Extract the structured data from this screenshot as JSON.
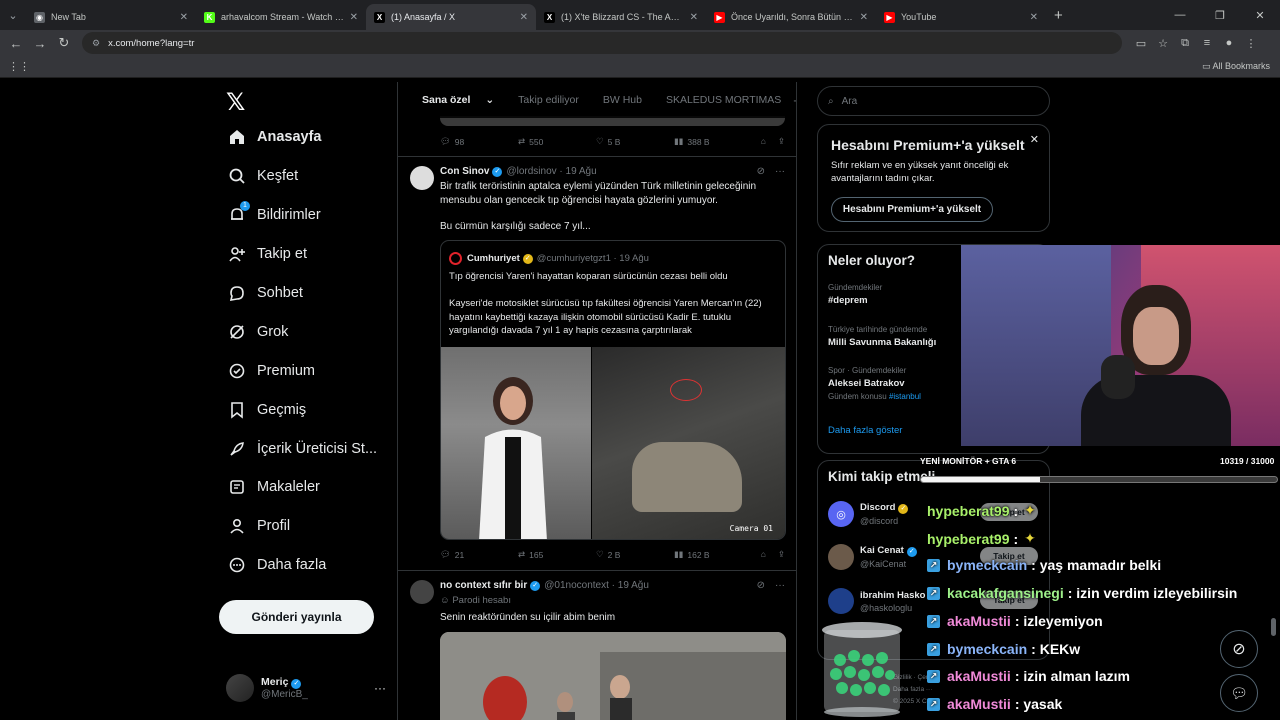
{
  "browser": {
    "tabs": [
      {
        "label": "New Tab",
        "color": "#5f6368",
        "glyph": "◉"
      },
      {
        "label": "arhavalcom Stream - Watch Liv",
        "color": "#53fc18",
        "glyph": "K"
      },
      {
        "label": "(1) Anasayfa / X",
        "color": "#000000",
        "glyph": "X"
      },
      {
        "label": "(1) X'te Blizzard CS - The Ameri",
        "color": "#000000",
        "glyph": "X"
      },
      {
        "label": "Önce Uyarıldı, Sonra Bütün Ma",
        "color": "#ff0000",
        "glyph": "▶"
      },
      {
        "label": "YouTube",
        "color": "#ff0000",
        "glyph": "▶"
      }
    ],
    "url": "x.com/home?lang=tr",
    "all_bookmarks": "All Bookmarks"
  },
  "nav": {
    "items": [
      {
        "label": "Anasayfa",
        "icon": "home-icon"
      },
      {
        "label": "Keşfet",
        "icon": "search-icon"
      },
      {
        "label": "Bildirimler",
        "icon": "bell-icon"
      },
      {
        "label": "Takip et",
        "icon": "follow-icon"
      },
      {
        "label": "Sohbet",
        "icon": "chat-icon"
      },
      {
        "label": "Grok",
        "icon": "grok-icon"
      },
      {
        "label": "Premium",
        "icon": "premium-icon"
      },
      {
        "label": "Geçmiş",
        "icon": "bookmark-icon"
      },
      {
        "label": "İçerik Üreticisi St...",
        "icon": "rocket-icon"
      },
      {
        "label": "Makaleler",
        "icon": "article-icon"
      },
      {
        "label": "Profil",
        "icon": "profile-icon"
      },
      {
        "label": "Daha fazla",
        "icon": "more-icon"
      }
    ],
    "notif_badge": "1",
    "post_button": "Gönderi yayınla",
    "user_name": "Meriç",
    "user_handle": "@MericB_"
  },
  "timeline": {
    "tabs": [
      "Sana özel",
      "Takip ediliyor",
      "BW Hub",
      "SKALEDUS MORTIMAS"
    ],
    "top_actions": {
      "replies": "98",
      "reposts": "550",
      "likes": "5 B",
      "views": "388 B"
    },
    "post1": {
      "name": "Con Sinov",
      "meta": "@lordsinov · 19 Ağu",
      "text1": "Bir trafik teröristinin aptalca eylemi yüzünden Türk milletinin geleceğinin mensubu olan gencecik tıp öğrencisi hayata gözlerini yumuyor.",
      "text2": "Bu cürmün karşılığı sadece 7 yıl...",
      "quote": {
        "name": "Cumhuriyet",
        "meta": "@cumhuriyetgzt1 · 19 Ağu",
        "line1": "Tıp öğrencisi Yaren'i hayattan koparan sürücünün cezası belli oldu",
        "line2": "Kayseri'de motosiklet sürücüsü tıp fakültesi öğrencisi Yaren Mercan'ın (22) hayatını kaybettiği kazaya ilişkin otomobil sürücüsü Kadir E. tutuklu yargılandığı davada 7 yıl 1 ay hapis cezasına çarptırılarak",
        "camera": "Camera 01"
      },
      "actions": {
        "replies": "21",
        "reposts": "165",
        "likes": "2 B",
        "views": "162 B"
      }
    },
    "post2": {
      "name": "no context sıfır bir",
      "meta": "@01nocontext · 19 Ağu",
      "sub": "Parodi hesabı",
      "text": "Senin reaktöründen su içilir abim benim"
    }
  },
  "right": {
    "search_placeholder": "Ara",
    "premium": {
      "title": "Hesabını Premium+'a yükselt",
      "desc": "Sıfır reklam ve en yüksek yanıt önceliği ek avantajlarını tadını çıkar.",
      "button": "Hesabını Premium+'a yükselt"
    },
    "trends_title": "Neler oluyor?",
    "trends": [
      {
        "context": "Gündemdekiler",
        "name": "#deprem",
        "extra": ""
      },
      {
        "context": "Türkiye tarihinde gündemde",
        "name": "Milli Savunma Bakanlığı",
        "extra": ""
      },
      {
        "context": "Spor · Gündemdekiler",
        "name": "Aleksei Batrakov",
        "extra_prefix": "Gündem konusu",
        "extra_tag": "#istanbul"
      }
    ],
    "trends_more": "Daha fazla göster",
    "who_title": "Kimi takip etmeli",
    "who": [
      {
        "name": "Discord",
        "handle": "@discord",
        "color": "#5865f2"
      },
      {
        "name": "Kai Cenat",
        "handle": "@KaiCenat",
        "color": "#6b5a4a"
      },
      {
        "name": "ibrahim Hasko",
        "handle": "@haskologlu",
        "color": "#1e3f8a"
      }
    ],
    "follow_label": "Takip et",
    "footer": "Gizlilik · Çerez\nDaha fazla ···\n© 2025 X Corp."
  },
  "stream": {
    "goal_label": "YENİ MONİTÖR + GTA 6",
    "goal_count": "10319 / 31000",
    "goal_fraction": 0.333,
    "chat": [
      {
        "user": "hypeberat99",
        "msg": ":",
        "user_color": "#a8f06a",
        "badge": false,
        "emote": true
      },
      {
        "user": "hypeberat99",
        "msg": ":",
        "user_color": "#a8f06a",
        "badge": false,
        "emote": true
      },
      {
        "user": "bymeckcain",
        "msg": ": yaş mamadır belki",
        "user_color": "#8ab4f8",
        "badge": true,
        "emote": false
      },
      {
        "user": "kacakafgansinegi",
        "msg": ": izin verdim izleyebilirsin",
        "user_color": "#9ef08a",
        "badge": true,
        "emote": false
      },
      {
        "user": "akaMustii",
        "msg": ": izleyemiyon",
        "user_color": "#f08ad8",
        "badge": true,
        "emote": false
      },
      {
        "user": "bymeckcain",
        "msg": ": KEKw",
        "user_color": "#8ab4f8",
        "badge": true,
        "emote": false
      },
      {
        "user": "akaMustii",
        "msg": ": izin alman lazım",
        "user_color": "#f08ad8",
        "badge": true,
        "emote": false
      },
      {
        "user": "akaMustii",
        "msg": ": yasak",
        "user_color": "#f08ad8",
        "badge": true,
        "emote": false
      }
    ]
  }
}
